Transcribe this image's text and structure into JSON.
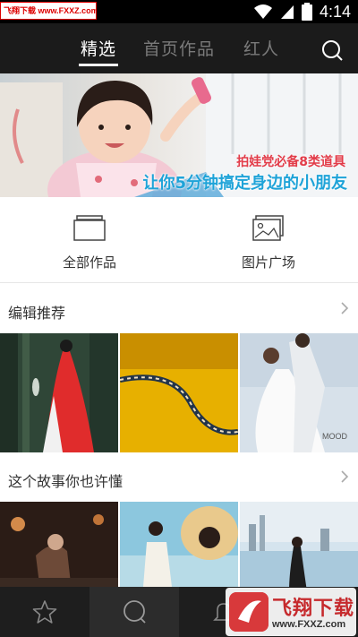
{
  "status": {
    "watermark": "飞翔下载 www.FXXZ.com",
    "time": "4:14"
  },
  "header": {
    "tabs": [
      {
        "label": "精选",
        "active": true
      },
      {
        "label": "首页作品",
        "active": false
      },
      {
        "label": "红人",
        "active": false
      }
    ]
  },
  "banner": {
    "line1": "拍娃党必备8类道具",
    "line2": "让你5分钟搞定身边的小朋友"
  },
  "categories": [
    {
      "label": "全部作品",
      "icon": "folder-icon"
    },
    {
      "label": "图片广场",
      "icon": "picture-icon"
    }
  ],
  "sections": [
    {
      "title": "编辑推荐"
    },
    {
      "title": "这个故事你也许懂"
    }
  ],
  "photo_caption": "MOOD",
  "watermark_bottom": {
    "name": "飞翔下载",
    "url": "www.FXXZ.com"
  },
  "colors": {
    "topbar": "#1b1b1b",
    "bottomnav": "#1e1e1e",
    "banner_red": "#e23c49",
    "banner_blue": "#1fa3d8"
  }
}
